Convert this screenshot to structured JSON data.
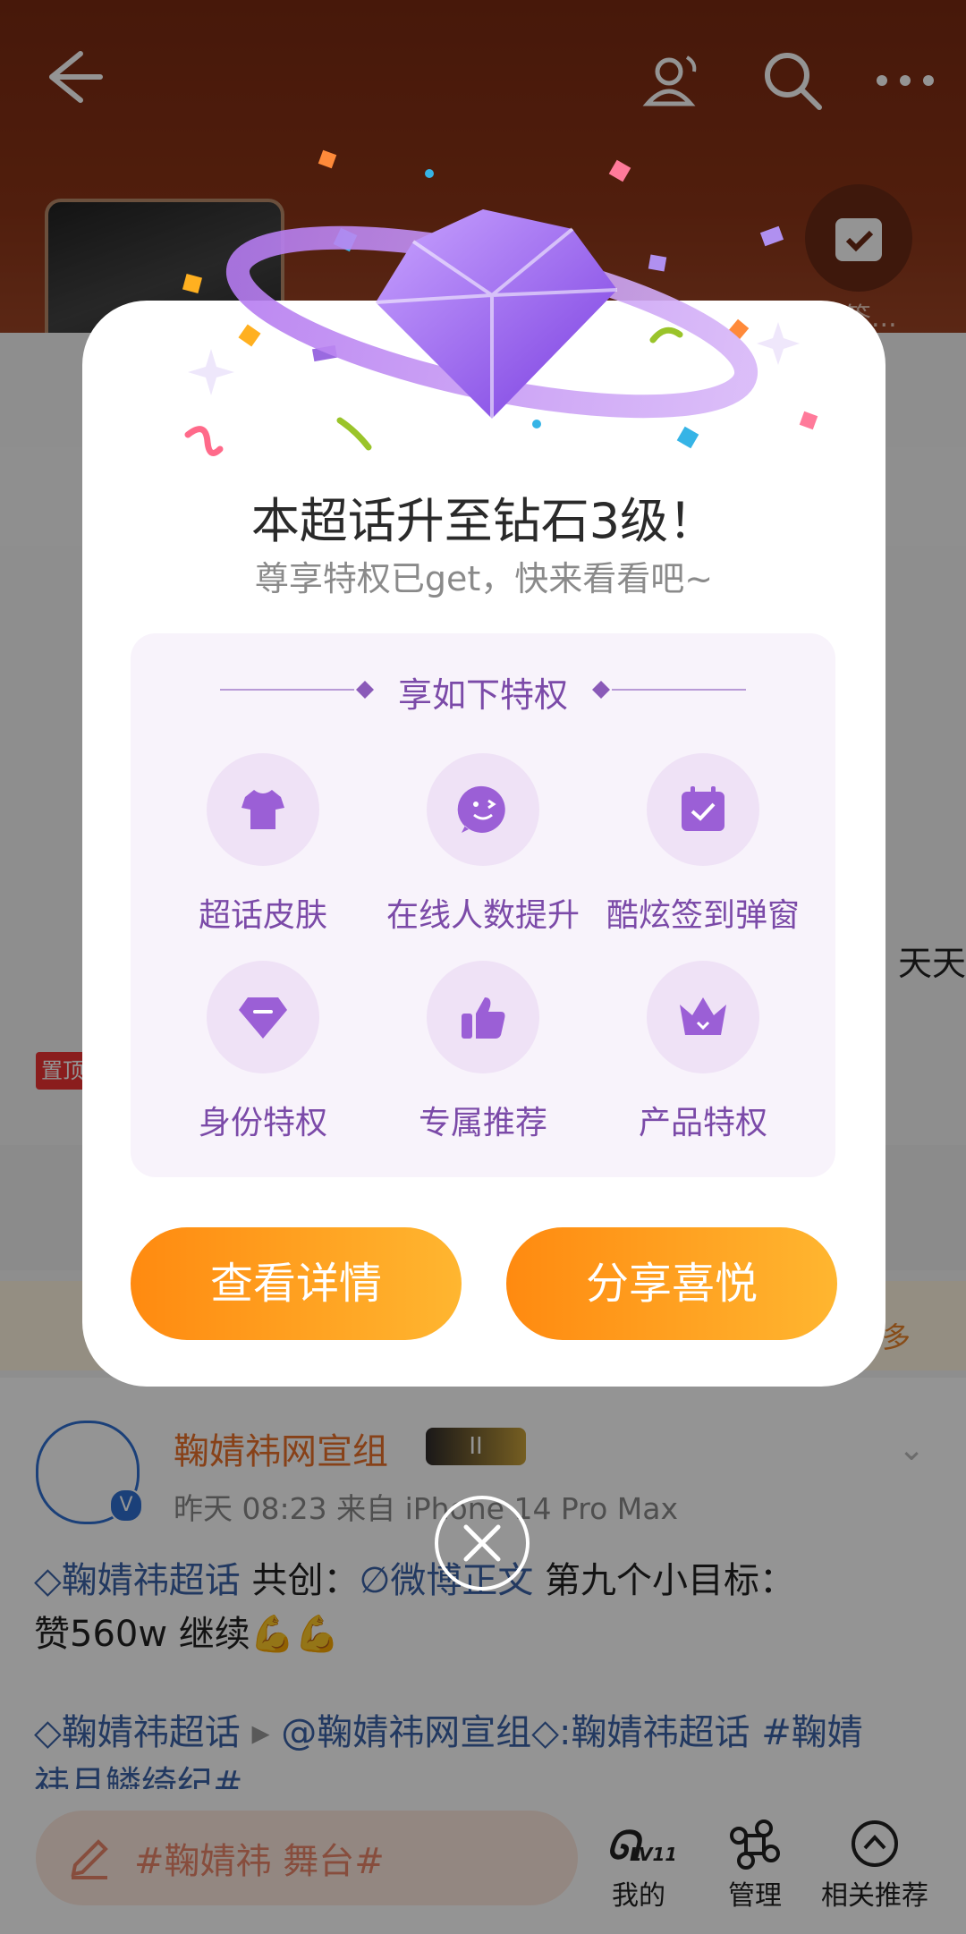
{
  "background": {
    "checkin_label": "连续签...",
    "side_text": "天天",
    "pin_label": "置顶",
    "band_more": "多",
    "post": {
      "author": "鞠婧祎网宣组",
      "crown_level": "II",
      "meta": "昨天 08:23  来自 iPhone 14 Pro Max",
      "line1_tag": "鞠婧祎超话",
      "line1_text1": " 共创：",
      "line1_link": "微博正文",
      "line1_text2": " 第九个小目标：",
      "line2": "赞560w  继续💪💪",
      "line3_tag1": "鞠婧祎超话",
      "line3_mention": "@鞠婧祎网宣组",
      "line3_tag2": ":鞠婧祎超话",
      "line3_hashtag": " #鞠婧",
      "line4": "祎月鳞绮纪#"
    },
    "bottom_bar": {
      "compose_placeholder": "#鞠婧祎 舞台#",
      "mine": "我的",
      "mine_level": "LV11",
      "manage": "管理",
      "recommend": "相关推荐"
    }
  },
  "modal": {
    "title": "本超话升至钻石3级！",
    "subtitle": "尊享特权已get，快来看看吧~",
    "perks_heading": "享如下特权",
    "perks": [
      {
        "label": "超话皮肤",
        "icon": "shirt-icon"
      },
      {
        "label": "在线人数提升",
        "icon": "wink-face-icon"
      },
      {
        "label": "酷炫签到弹窗",
        "icon": "calendar-check-icon"
      },
      {
        "label": "身份特权",
        "icon": "diamond-icon"
      },
      {
        "label": "专属推荐",
        "icon": "thumbs-up-icon"
      },
      {
        "label": "产品特权",
        "icon": "crown-icon"
      }
    ],
    "btn_detail": "查看详情",
    "btn_share": "分享喜悦"
  },
  "colors": {
    "accent_orange": "#ff8a10",
    "perk_purple": "#7b4aa8",
    "link_blue": "#3b63a8"
  }
}
